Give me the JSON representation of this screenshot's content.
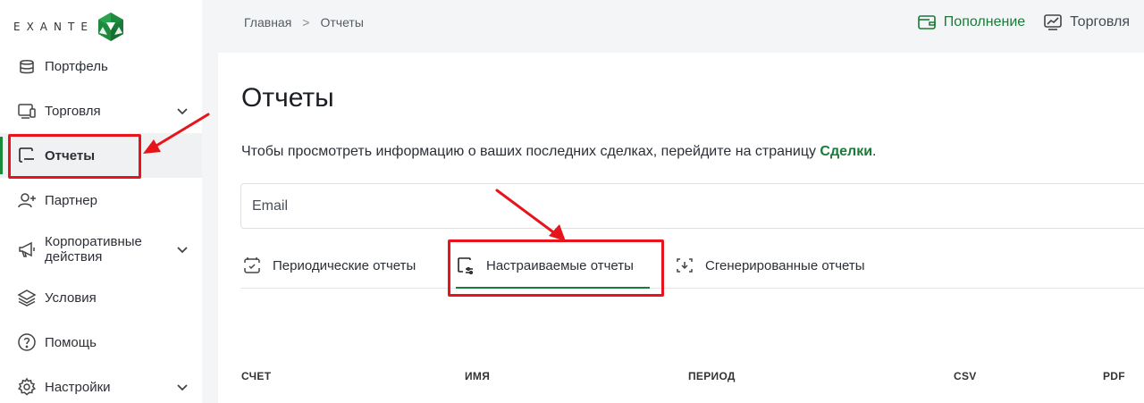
{
  "brand": {
    "logo_text": "EXANTE",
    "accent": "#1a7a37"
  },
  "sidebar": {
    "items": [
      {
        "label": "Портфель",
        "icon": "wallet-icon"
      },
      {
        "label": "Торговля",
        "icon": "trading-terminal-icon",
        "expandable": true
      },
      {
        "label": "Отчеты",
        "icon": "reports-icon",
        "active": true
      },
      {
        "label": "Партнер",
        "icon": "partner-add-user-icon"
      },
      {
        "label": "Корпоративные",
        "label2": "действия",
        "icon": "megaphone-icon",
        "expandable": true
      },
      {
        "label": "Условия",
        "icon": "layers-icon"
      },
      {
        "label": "Помощь",
        "icon": "help-icon"
      },
      {
        "label": "Настройки",
        "icon": "gear-icon",
        "expandable": true
      }
    ]
  },
  "topbar": {
    "breadcrumb": {
      "home": "Главная",
      "separator": ">",
      "current": "Отчеты"
    },
    "deposit_label": "Пополнение",
    "trade_label": "Торговля"
  },
  "main": {
    "title": "Отчеты",
    "info_text": "Чтобы просмотреть информацию о ваших последних сделках, перейдите на страницу ",
    "info_link": "Сделки",
    "info_end": ".",
    "email_placeholder": "Email",
    "tabs": [
      {
        "label": "Периодические отчеты",
        "icon": "calendar-check-icon"
      },
      {
        "label": "Настраиваемые отчеты",
        "icon": "custom-report-icon",
        "active": true
      },
      {
        "label": "Сгенерированные отчеты",
        "icon": "download-frame-icon"
      }
    ],
    "table_headers": [
      "СЧЕТ",
      "ИМЯ",
      "ПЕРИОД",
      "CSV",
      "PDF"
    ]
  }
}
